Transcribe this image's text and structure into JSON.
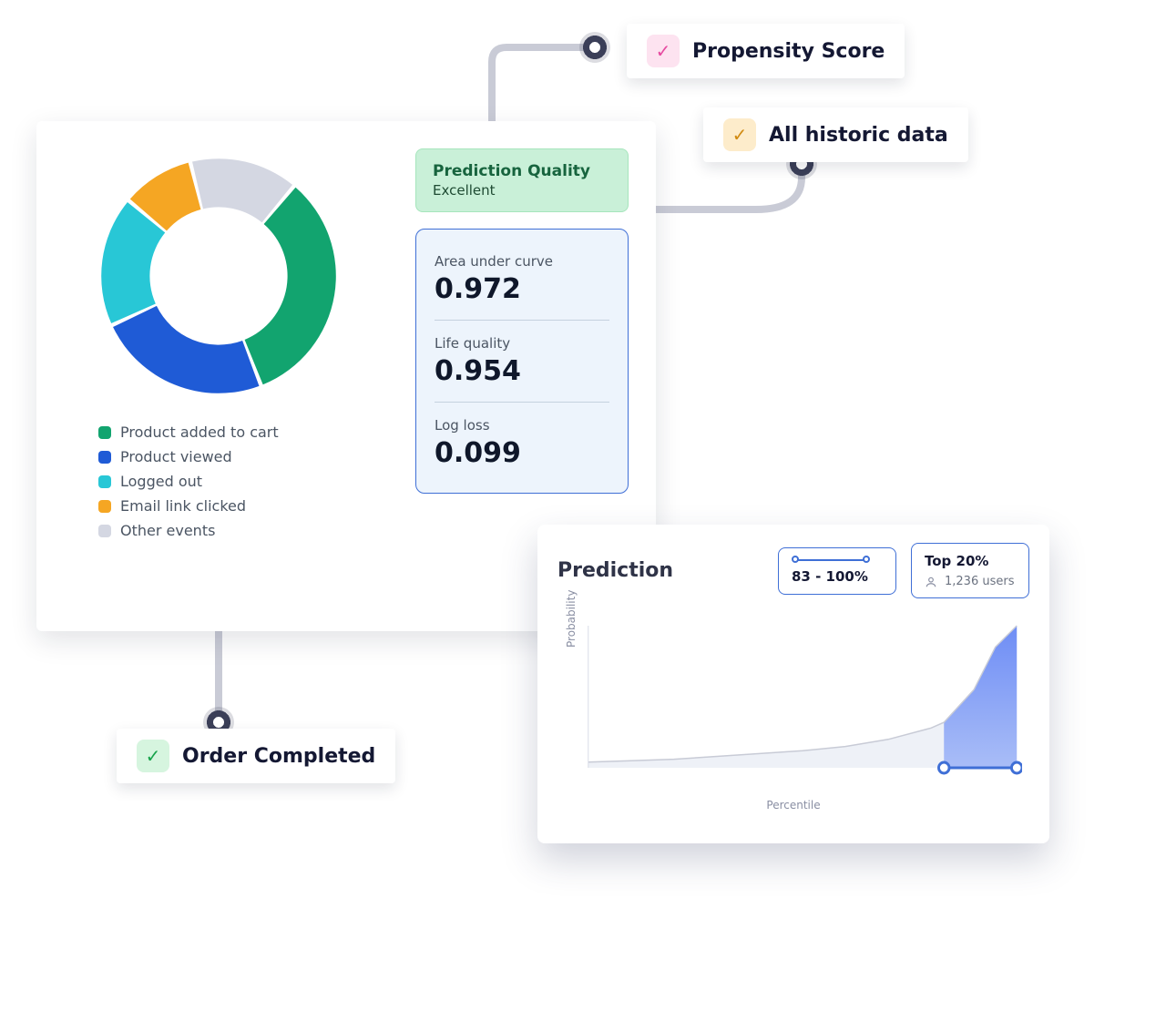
{
  "pills": {
    "propensity": {
      "label": "Propensity Score",
      "check_style": "pink"
    },
    "historic": {
      "label": "All historic data",
      "check_style": "amber"
    },
    "order": {
      "label": "Order Completed",
      "check_style": "mint"
    }
  },
  "quality": {
    "title": "Prediction Quality",
    "value": "Excellent"
  },
  "metrics": [
    {
      "label": "Area under curve",
      "value": "0.972"
    },
    {
      "label": "Life quality",
      "value": "0.954"
    },
    {
      "label": "Log loss",
      "value": "0.099"
    }
  ],
  "legend": [
    {
      "label": "Product added to cart",
      "color": "#12a46f"
    },
    {
      "label": "Product viewed",
      "color": "#1f5bd6"
    },
    {
      "label": "Logged out",
      "color": "#28c7d6"
    },
    {
      "label": "Email link clicked",
      "color": "#f5a623"
    },
    {
      "label": "Other events",
      "color": "#d4d7e2"
    }
  ],
  "prediction": {
    "title": "Prediction",
    "range_label": "83 - 100%",
    "top_label": "Top 20%",
    "users_label": "1,236 users",
    "ylabel": "Probability",
    "xlabel": "Percentile"
  },
  "chart_data": [
    {
      "type": "pie",
      "title": "Event distribution",
      "series": [
        {
          "name": "Product added to cart",
          "value": 33,
          "color": "#12a46f"
        },
        {
          "name": "Product viewed",
          "value": 24,
          "color": "#1f5bd6"
        },
        {
          "name": "Logged out",
          "value": 18,
          "color": "#28c7d6"
        },
        {
          "name": "Email link clicked",
          "value": 10,
          "color": "#f5a623"
        },
        {
          "name": "Other events",
          "value": 15,
          "color": "#d4d7e2"
        }
      ]
    },
    {
      "type": "area",
      "title": "Prediction",
      "xlabel": "Percentile",
      "ylabel": "Probability",
      "xlim": [
        0,
        100
      ],
      "ylim": [
        0,
        100
      ],
      "highlight_range": [
        83,
        100
      ],
      "series": [
        {
          "name": "Probability",
          "x": [
            0,
            10,
            20,
            30,
            40,
            50,
            60,
            70,
            80,
            83,
            90,
            95,
            100
          ],
          "y": [
            4,
            5,
            6,
            8,
            10,
            12,
            15,
            20,
            28,
            32,
            55,
            85,
            100
          ]
        }
      ]
    }
  ]
}
